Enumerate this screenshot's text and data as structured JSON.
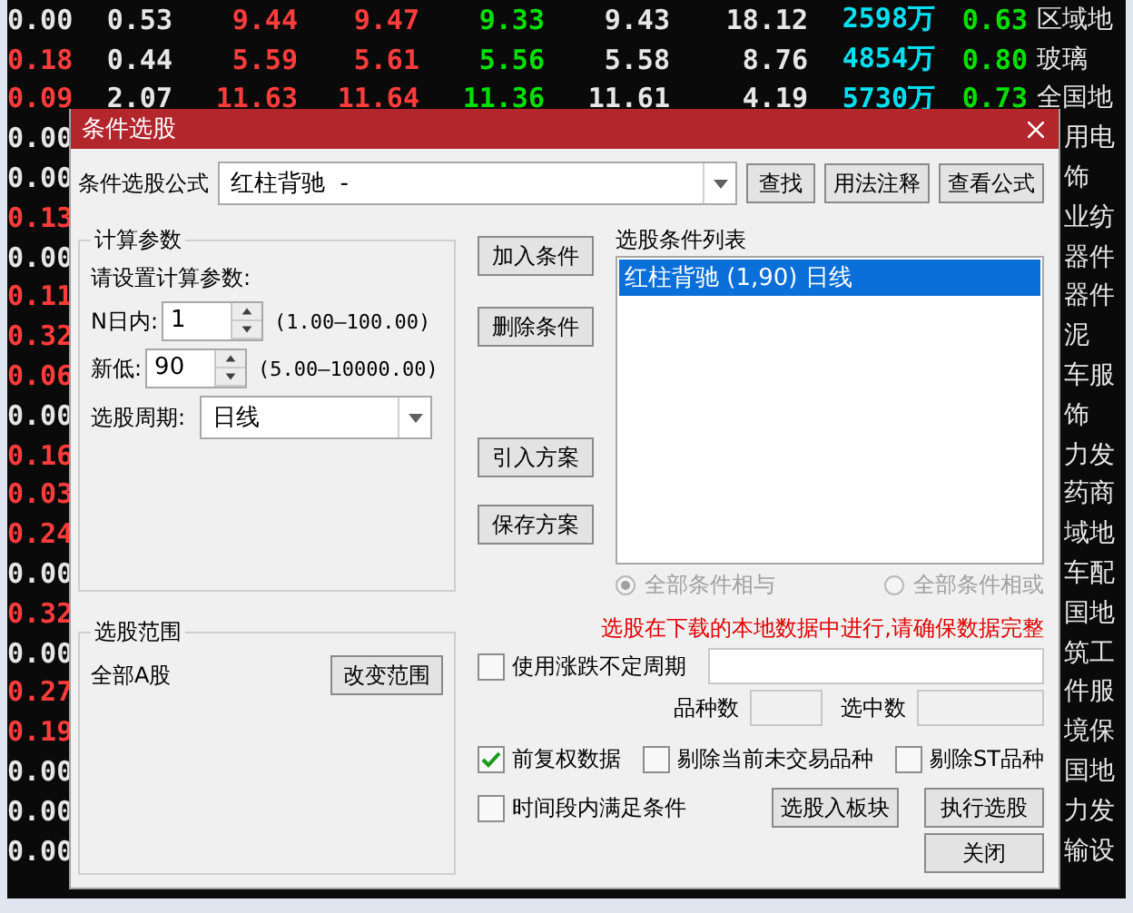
{
  "quote_table": {
    "rows": [
      {
        "change": {
          "text": "0.00",
          "color": "#e6e6e6"
        },
        "cells": [
          {
            "text": "0.53",
            "color": "#e6e6e6"
          },
          {
            "text": "9.44",
            "color": "#ff3c3c"
          },
          {
            "text": "9.47",
            "color": "#ff3c3c"
          },
          {
            "text": "9.33",
            "color": "#00e000"
          },
          {
            "text": "9.43",
            "color": "#e6e6e6"
          },
          {
            "text": "18.12",
            "color": "#e6e6e6"
          },
          {
            "text": "2598万",
            "color": "#00e0f0"
          },
          {
            "text": "0.63",
            "color": "#00e000"
          }
        ],
        "name": "区域地"
      },
      {
        "change": {
          "text": "0.18",
          "color": "#ff3c3c"
        },
        "cells": [
          {
            "text": "0.44",
            "color": "#e6e6e6"
          },
          {
            "text": "5.59",
            "color": "#ff3c3c"
          },
          {
            "text": "5.61",
            "color": "#ff3c3c"
          },
          {
            "text": "5.56",
            "color": "#00e000"
          },
          {
            "text": "5.58",
            "color": "#e6e6e6"
          },
          {
            "text": "8.76",
            "color": "#e6e6e6"
          },
          {
            "text": "4854万",
            "color": "#00e0f0"
          },
          {
            "text": "0.80",
            "color": "#00e000"
          }
        ],
        "name": "玻璃"
      },
      {
        "change": {
          "text": "0.09",
          "color": "#ff3c3c"
        },
        "cells": [
          {
            "text": "2.07",
            "color": "#e6e6e6"
          },
          {
            "text": "11.63",
            "color": "#ff3c3c"
          },
          {
            "text": "11.64",
            "color": "#ff3c3c"
          },
          {
            "text": "11.36",
            "color": "#00e000"
          },
          {
            "text": "11.61",
            "color": "#e6e6e6"
          },
          {
            "text": "4.19",
            "color": "#e6e6e6"
          },
          {
            "text": "5730万",
            "color": "#00e0f0"
          },
          {
            "text": "0.73",
            "color": "#00e000"
          }
        ],
        "name": "全国地"
      },
      {
        "change": {
          "text": "0.00",
          "color": "#e6e6e6"
        },
        "name": "用电"
      },
      {
        "change": {
          "text": "0.00",
          "color": "#e6e6e6"
        },
        "name": "饰"
      },
      {
        "change": {
          "text": "0.13",
          "color": "#ff3c3c"
        },
        "name": "业纺"
      },
      {
        "change": {
          "text": "0.00",
          "color": "#e6e6e6"
        },
        "name": "器件"
      },
      {
        "change": {
          "text": "0.11",
          "color": "#ff3c3c"
        },
        "name": "器件"
      },
      {
        "change": {
          "text": "0.32",
          "color": "#ff3c3c"
        },
        "name": "泥"
      },
      {
        "change": {
          "text": "0.06",
          "color": "#ff3c3c"
        },
        "name": "车服"
      },
      {
        "change": {
          "text": "0.00",
          "color": "#e6e6e6"
        },
        "name": "饰"
      },
      {
        "change": {
          "text": "0.16",
          "color": "#ff3c3c"
        },
        "name": "力发"
      },
      {
        "change": {
          "text": "0.03",
          "color": "#ff3c3c"
        },
        "name": "药商"
      },
      {
        "change": {
          "text": "0.24",
          "color": "#ff3c3c"
        },
        "name": "域地"
      },
      {
        "change": {
          "text": "0.00",
          "color": "#e6e6e6"
        },
        "name": "车配"
      },
      {
        "change": {
          "text": "0.32",
          "color": "#ff3c3c"
        },
        "name": "国地"
      },
      {
        "change": {
          "text": "0.00",
          "color": "#e6e6e6"
        },
        "name": "筑工"
      },
      {
        "change": {
          "text": "0.27",
          "color": "#ff3c3c"
        },
        "name": "件服"
      },
      {
        "change": {
          "text": "0.19",
          "color": "#ff3c3c"
        },
        "name": "境保"
      },
      {
        "change": {
          "text": "0.00",
          "color": "#e6e6e6"
        },
        "name": "国地"
      },
      {
        "change": {
          "text": "0.00",
          "color": "#e6e6e6"
        },
        "name": "力发"
      },
      {
        "change": {
          "text": "0.00",
          "color": "#e6e6e6"
        },
        "name": "输设"
      }
    ]
  },
  "dialog": {
    "title": "条件选股",
    "formula": {
      "label": "条件选股公式",
      "value": "红柱背驰  -"
    },
    "top_buttons": [
      "查找",
      "用法注释",
      "查看公式"
    ],
    "params": {
      "title": "计算参数",
      "prompt": "请设置计算参数:",
      "items": [
        {
          "label": "N日内:",
          "value": "1",
          "range": "(1.00—100.00)"
        },
        {
          "label": "新低:",
          "value": "90",
          "range": "(5.00—10000.00)"
        }
      ],
      "period_label": "选股周期:",
      "period_value": "日线"
    },
    "side_buttons": [
      "加入条件",
      "删除条件",
      "引入方案",
      "保存方案"
    ],
    "conditions": {
      "title": "选股条件列表",
      "items": [
        {
          "text": "红柱背驰 (1,90) 日线",
          "selected": true
        }
      ]
    },
    "combine": [
      {
        "label": "全部条件相与",
        "selected": true,
        "disabled": true
      },
      {
        "label": "全部条件相或",
        "selected": false,
        "disabled": true
      }
    ],
    "notice": "选股在下载的本地数据中进行,请确保数据完整",
    "scope": {
      "title": "选股范围",
      "value": "全部A股",
      "button": "改变范围"
    },
    "variable_period": {
      "label": "使用涨跌不定周期",
      "checked": false
    },
    "counts": [
      {
        "label": "品种数"
      },
      {
        "label": "选中数"
      }
    ],
    "options": [
      {
        "label": "前复权数据",
        "checked": true
      },
      {
        "label": "剔除当前未交易品种",
        "checked": false
      },
      {
        "label": "剔除ST品种",
        "checked": false
      }
    ],
    "time_condition": {
      "label": "时间段内满足条件",
      "checked": false
    },
    "bottom_buttons": [
      "选股入板块",
      "执行选股"
    ],
    "close_button": "关闭"
  }
}
